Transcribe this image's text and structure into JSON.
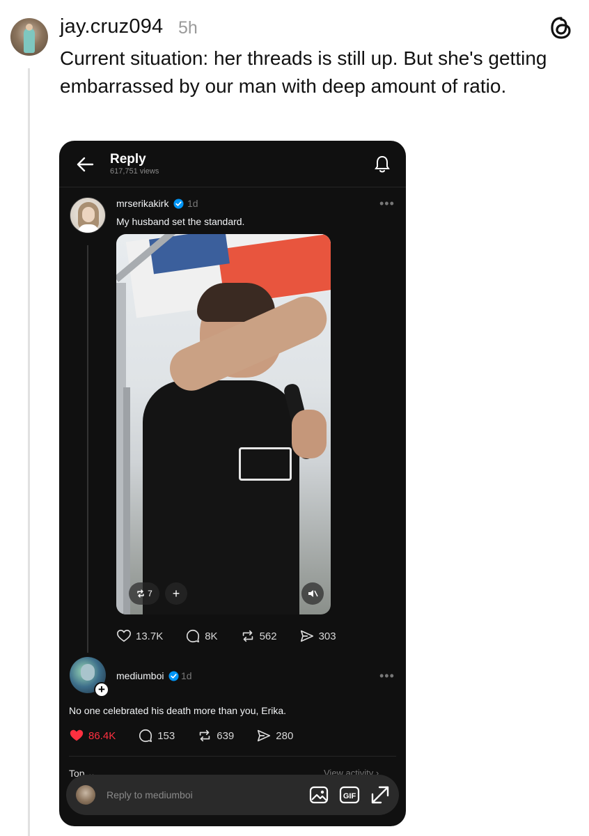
{
  "post": {
    "username": "jay.cruz094",
    "time": "5h",
    "text": "Current situation: her threads is still up.  But she's getting embarrassed by our man with deep amount of ratio."
  },
  "screenshot": {
    "header": {
      "title": "Reply",
      "views": "617,751 views"
    },
    "original_post": {
      "username": "mrserikakirk",
      "time": "1d",
      "text": "My husband set the standard.",
      "video": {
        "reposts": "7",
        "add": "+"
      },
      "stats": {
        "likes": "13.7K",
        "comments": "8K",
        "reposts": "562",
        "shares": "303"
      }
    },
    "reply": {
      "username": "mediumboi",
      "time": "1d",
      "text": "No one celebrated his death more than you, Erika.",
      "stats": {
        "likes": "86.4K",
        "comments": "153",
        "reposts": "639",
        "shares": "280"
      }
    },
    "footer": {
      "sort": "Top",
      "view_activity": "View activity",
      "reply_placeholder": "Reply to mediumboi"
    },
    "colors": {
      "background": "#101010",
      "like_active": "#ff3040",
      "verified": "#0095f6"
    }
  }
}
